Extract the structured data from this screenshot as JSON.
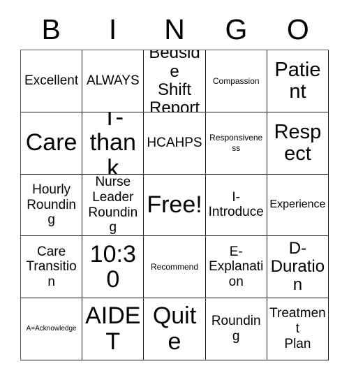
{
  "card": {
    "title": "BINGO",
    "headers": [
      "B",
      "I",
      "N",
      "G",
      "O"
    ],
    "colors": {
      "text": "#000000",
      "cell_background": "#ffffff",
      "border": "#1a1a1a",
      "page_background": "#ffffff"
    },
    "rows": [
      [
        {
          "text": "Excellent",
          "size": "md"
        },
        {
          "text": "ALWAYS",
          "size": "md"
        },
        {
          "text": "Bedside\nShift\nReport",
          "size": "lg"
        },
        {
          "text": "Compassion",
          "size": "xs"
        },
        {
          "text": "Patient",
          "size": "xl"
        }
      ],
      [
        {
          "text": "Care",
          "size": "xxl"
        },
        {
          "text": "T-\nthank",
          "size": "xxl"
        },
        {
          "text": "HCAHPS",
          "size": "md"
        },
        {
          "text": "Responsiveness",
          "size": "xs"
        },
        {
          "text": "Respect",
          "size": "xl"
        }
      ],
      [
        {
          "text": "Hourly\nRounding",
          "size": "md"
        },
        {
          "text": "Nurse\nLeader\nRounding",
          "size": "md"
        },
        {
          "text": "Free!",
          "size": "xxl"
        },
        {
          "text": "I-\nIntroduce",
          "size": "md"
        },
        {
          "text": "Experience",
          "size": "sm"
        }
      ],
      [
        {
          "text": "Care\nTransition",
          "size": "md"
        },
        {
          "text": "10:30",
          "size": "xxl"
        },
        {
          "text": "Recommend",
          "size": "xs"
        },
        {
          "text": "E-\nExplanation",
          "size": "md"
        },
        {
          "text": "D-\nDuration",
          "size": "lg"
        }
      ],
      [
        {
          "text": "A=Acknowledge",
          "size": "xxs"
        },
        {
          "text": "AIDET",
          "size": "xxl"
        },
        {
          "text": "Quite",
          "size": "xxl"
        },
        {
          "text": "Rounding",
          "size": "md"
        },
        {
          "text": "Treatment\nPlan",
          "size": "md"
        }
      ]
    ]
  }
}
